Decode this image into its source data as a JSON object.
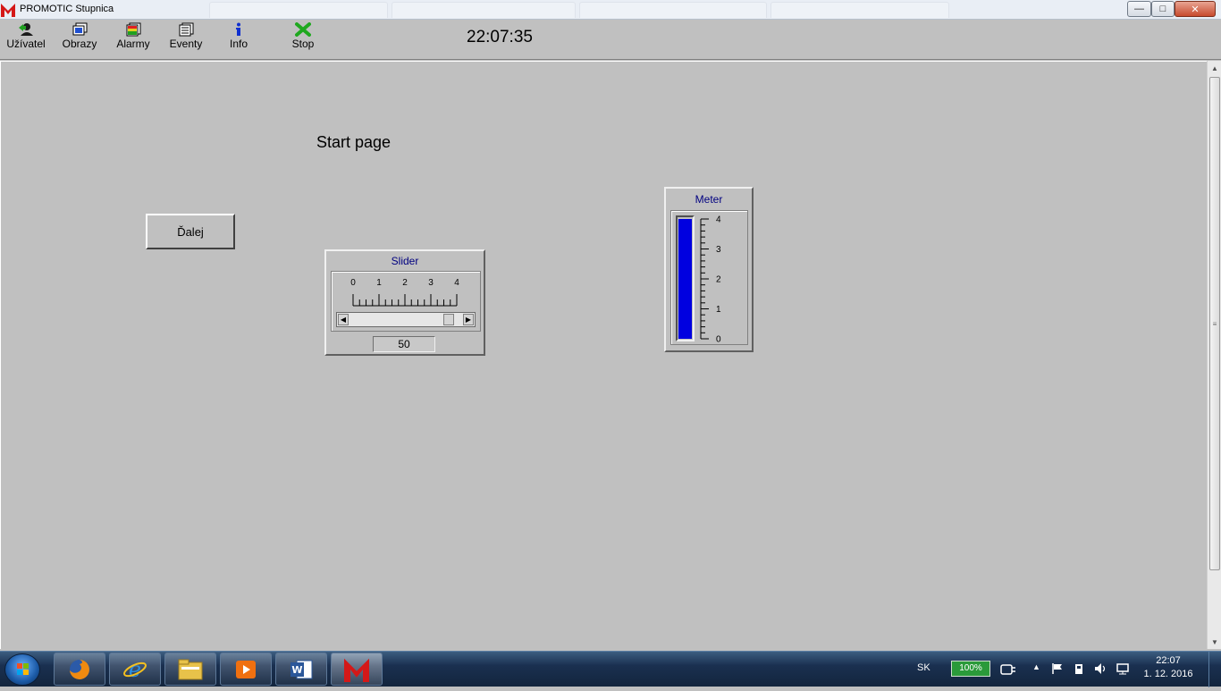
{
  "window": {
    "title": "PROMOTIC Stupnica",
    "controls": {
      "minimize": "—",
      "maximize": "□",
      "close": "✕"
    }
  },
  "toolbar": {
    "items": [
      {
        "label": "Užívatel",
        "icon": "user-icon"
      },
      {
        "label": "Obrazy",
        "icon": "screens-icon"
      },
      {
        "label": "Alarmy",
        "icon": "alarms-icon"
      },
      {
        "label": "Eventy",
        "icon": "events-icon"
      },
      {
        "label": "Info",
        "icon": "info-icon"
      },
      {
        "label": "Stop",
        "icon": "stop-icon"
      }
    ],
    "clock": "22:07:35"
  },
  "main": {
    "page_title": "Start page",
    "next_button": "Ďalej",
    "slider": {
      "title": "Slider",
      "scale_labels": [
        "0",
        "1",
        "2",
        "3",
        "4"
      ],
      "value_display": "50",
      "position_fraction": 0.92
    },
    "meter": {
      "title": "Meter",
      "scale_labels": [
        "4",
        "3",
        "2",
        "1",
        "0"
      ],
      "max": 4,
      "value_fraction": 0.98,
      "fill_color": "#0000e0"
    }
  },
  "taskbar": {
    "apps": [
      "firefox-icon",
      "internet-explorer-icon",
      "file-explorer-icon",
      "media-player-icon",
      "word-icon",
      "promotic-icon"
    ],
    "language": "SK",
    "battery": "100%",
    "time": "22:07",
    "date": "1. 12. 2016"
  },
  "colors": {
    "background": "#c0c0c0",
    "widget_title": "#000080",
    "stop_green": "#1fa81f",
    "logo_red": "#d41818"
  }
}
